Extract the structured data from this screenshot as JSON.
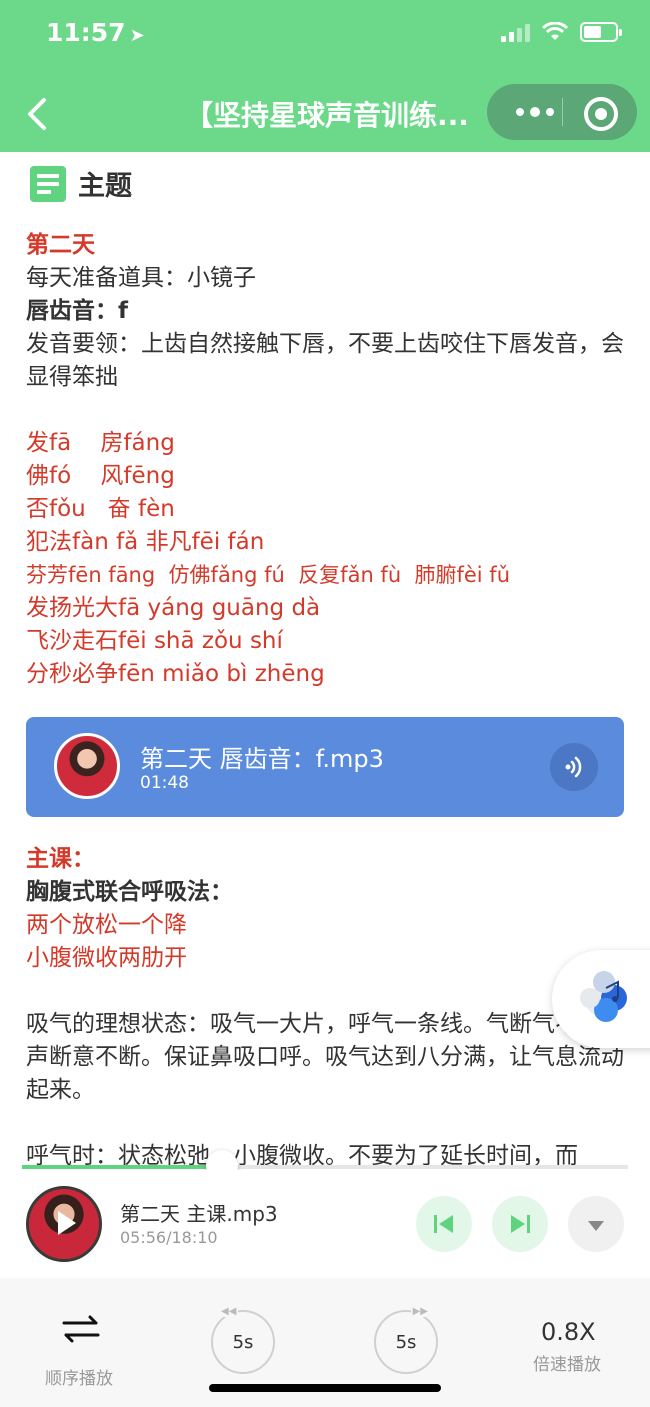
{
  "status": {
    "time": "11:57"
  },
  "nav": {
    "title": "【坚持星球声音训练..."
  },
  "topic": {
    "label": "主题"
  },
  "article": {
    "day": "第二天",
    "props": "每天准备道具：小镜子",
    "sound_title": "唇齿音：f",
    "tips": "发音要领：上齿自然接触下唇，不要上齿咬住下唇发音，会显得笨拙",
    "words": [
      "发fā    房fáng",
      "佛fó    风fēng",
      "否fǒu   奋 fèn",
      "犯法fàn fǎ 非凡fēi fán",
      "芬芳fēn fāng  仿佛fǎng fú  反复fǎn fù  肺腑fèi fǔ",
      "发扬光大fā yáng guāng dà",
      "飞沙走石fēi shā zǒu shí",
      "分秒必争fēn miǎo bì zhēng"
    ]
  },
  "audio_card": {
    "title": "第二天 唇齿音：f.mp3",
    "duration": "01:48"
  },
  "article2": {
    "main_label": "主课：",
    "method": "胸腹式联合呼吸法：",
    "mnemonic1": "两个放松一个降",
    "mnemonic2": "小腹微收两肋开",
    "para1": "吸气的理想状态：吸气一大片，呼气一条线。气断气不断，声断意不断。保证鼻吸口呼。吸气达到八分满，让气息流动起来。",
    "para2": "呼气时：状态松弛，小腹微收。不要为了延长时间，而"
  },
  "player": {
    "track": "第二天 主课.mp3",
    "time": "05:56/18:10",
    "progress": 0.33
  },
  "controls": {
    "order_label": "顺序播放",
    "back_label": "5s",
    "fwd_label": "5s",
    "speed_value": "0.8X",
    "speed_label": "倍速播放"
  },
  "colors": {
    "header": "#6cd98a",
    "accent": "#5fd37f",
    "red": "#d43a2a",
    "card": "#5a8bdc"
  }
}
